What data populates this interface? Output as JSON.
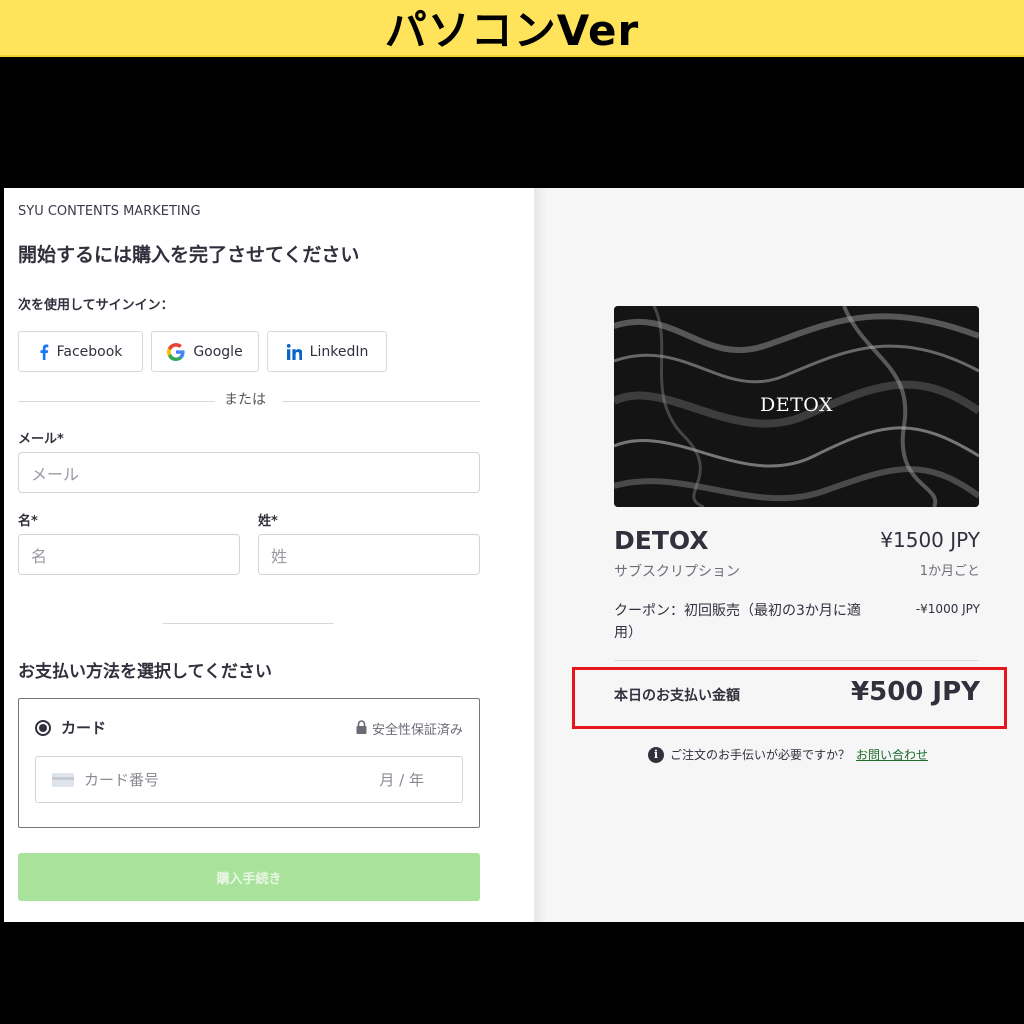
{
  "banner": {
    "title": "パソコンVer"
  },
  "checkout": {
    "merchant_name": "SYU CONTENTS MARKETING",
    "page_title": "開始するには購入を完了させてください",
    "signin_label": "次を使用してサインイン：",
    "social_buttons": [
      {
        "label": "Facebook",
        "icon": "facebook-icon"
      },
      {
        "label": "Google",
        "icon": "google-icon"
      },
      {
        "label": "LinkedIn",
        "icon": "linkedin-icon"
      }
    ],
    "or_text": "または",
    "email": {
      "label": "メール*",
      "placeholder": "メール",
      "value": ""
    },
    "first_name": {
      "label": "名*",
      "placeholder": "名",
      "value": ""
    },
    "last_name": {
      "label": "姓*",
      "placeholder": "姓",
      "value": ""
    },
    "payment_section_title": "お支払い方法を選択してください",
    "payment": {
      "method_label": "カード",
      "selected": true,
      "secure_label": "安全性保証済み",
      "card_number_placeholder": "カード番号",
      "expiry_placeholder": "月 / 年"
    },
    "purchase_button": "購入手続き"
  },
  "summary": {
    "image_text": "DETOX",
    "product_name": "DETOX",
    "product_price": "¥1500 JPY",
    "product_type": "サブスクリプション",
    "billing_period": "1か月ごと",
    "coupon_description": "クーポン：初回販売（最初の3か月に適用）",
    "coupon_amount": "-¥1000 JPY",
    "total_label": "本日のお支払い金額",
    "total_amount": "¥500 JPY",
    "help_text": "ご注文のお手伝いが必要ですか？",
    "help_link": "お問い合わせ"
  },
  "colors": {
    "banner": "#ffe35a",
    "highlight": "#e8141b",
    "purchase_button": "#a9e29b",
    "link": "#1a6b2a"
  }
}
